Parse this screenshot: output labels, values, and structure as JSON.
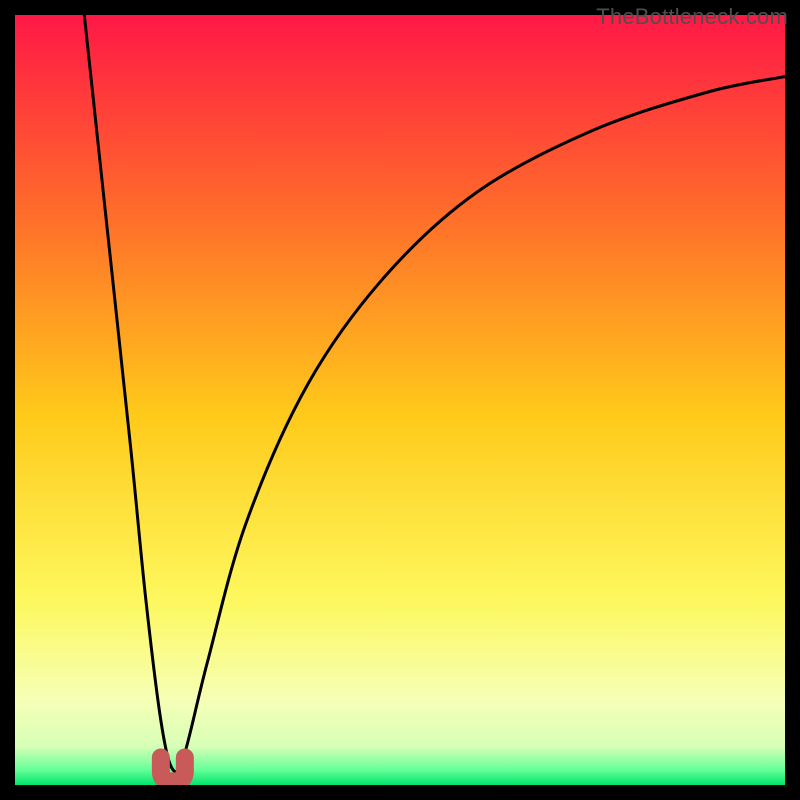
{
  "watermark": "TheBottleneck.com",
  "chart_data": {
    "type": "line",
    "title": "",
    "xlabel": "",
    "ylabel": "",
    "xlim": [
      0,
      100
    ],
    "ylim": [
      0,
      100
    ],
    "grid": false,
    "legend": false,
    "annotations": [],
    "background_gradient_stops": [
      {
        "pct": 0,
        "color": "#ff1846"
      },
      {
        "pct": 25,
        "color": "#ff6a2b"
      },
      {
        "pct": 52,
        "color": "#ffca1a"
      },
      {
        "pct": 76,
        "color": "#fdf85e"
      },
      {
        "pct": 89,
        "color": "#f6ffb6"
      },
      {
        "pct": 95,
        "color": "#d7ffb6"
      },
      {
        "pct": 98,
        "color": "#66ff99"
      },
      {
        "pct": 100,
        "color": "#00e56b"
      }
    ],
    "series": [
      {
        "name": "bottleneck-curve",
        "color": "#000000",
        "x": [
          9,
          12,
          15,
          17,
          19,
          20.5,
          22,
          25,
          30,
          38,
          48,
          60,
          75,
          90,
          100
        ],
        "y": [
          100,
          72,
          44,
          24,
          8,
          2,
          4,
          16,
          34,
          52,
          66,
          77,
          85,
          90,
          92
        ]
      }
    ],
    "marker": {
      "name": "optimal-point",
      "color": "#c85a5a",
      "x": 20.5,
      "y": 1.5,
      "shape": "u"
    }
  }
}
